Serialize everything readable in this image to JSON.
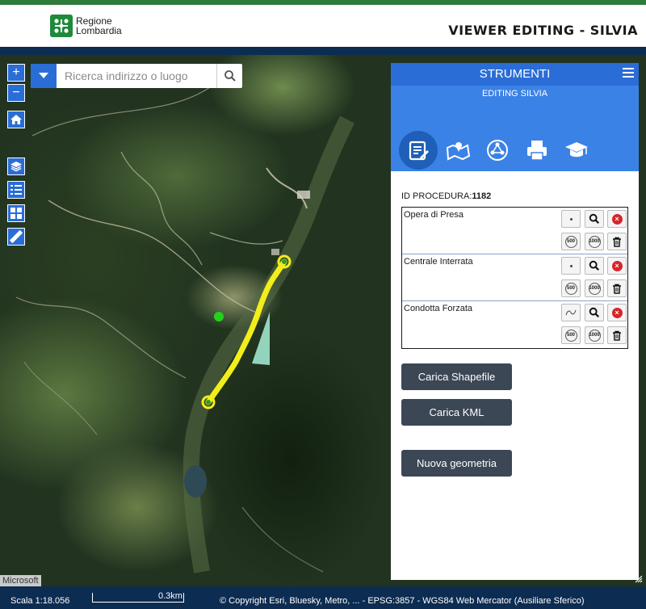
{
  "header": {
    "brand_line1": "Regione",
    "brand_line2": "Lombardia",
    "title": "VIEWER EDITING - SILVIA"
  },
  "map_controls": {
    "zoom_in": "+",
    "zoom_out": "−",
    "search_placeholder": "Ricerca indirizzo o luogo"
  },
  "panel": {
    "title": "STRUMENTI",
    "subtitle": "EDITING SILVIA",
    "id_label": "ID PROCEDURA:",
    "id_value": "1182",
    "items": [
      {
        "label": "Opera di Presa",
        "tool": "point-icon"
      },
      {
        "label": "Centrale Interrata",
        "tool": "point-icon"
      },
      {
        "label": "Condotta Forzata",
        "tool": "line-icon"
      }
    ],
    "buffer_labels": [
      "500",
      "1000"
    ],
    "buttons": {
      "shapefile": "Carica Shapefile",
      "kml": "Carica KML",
      "new_geom": "Nuova geometria"
    }
  },
  "status": {
    "scale": "Scala 1:18.056",
    "scale_bar": "0.3km",
    "projection": "© Copyright Esri, Bluesky, Metro, ... - EPSG:3857 - WGS84 Web Mercator (Ausiliare Sferico)",
    "attribution": "Microsoft"
  },
  "colors": {
    "accent": "#2a6dd6",
    "header_dark": "#0d2c52",
    "brand_green": "#1f8a3a",
    "line_yellow": "#f2ee1a",
    "button_dark": "#3c4756"
  }
}
